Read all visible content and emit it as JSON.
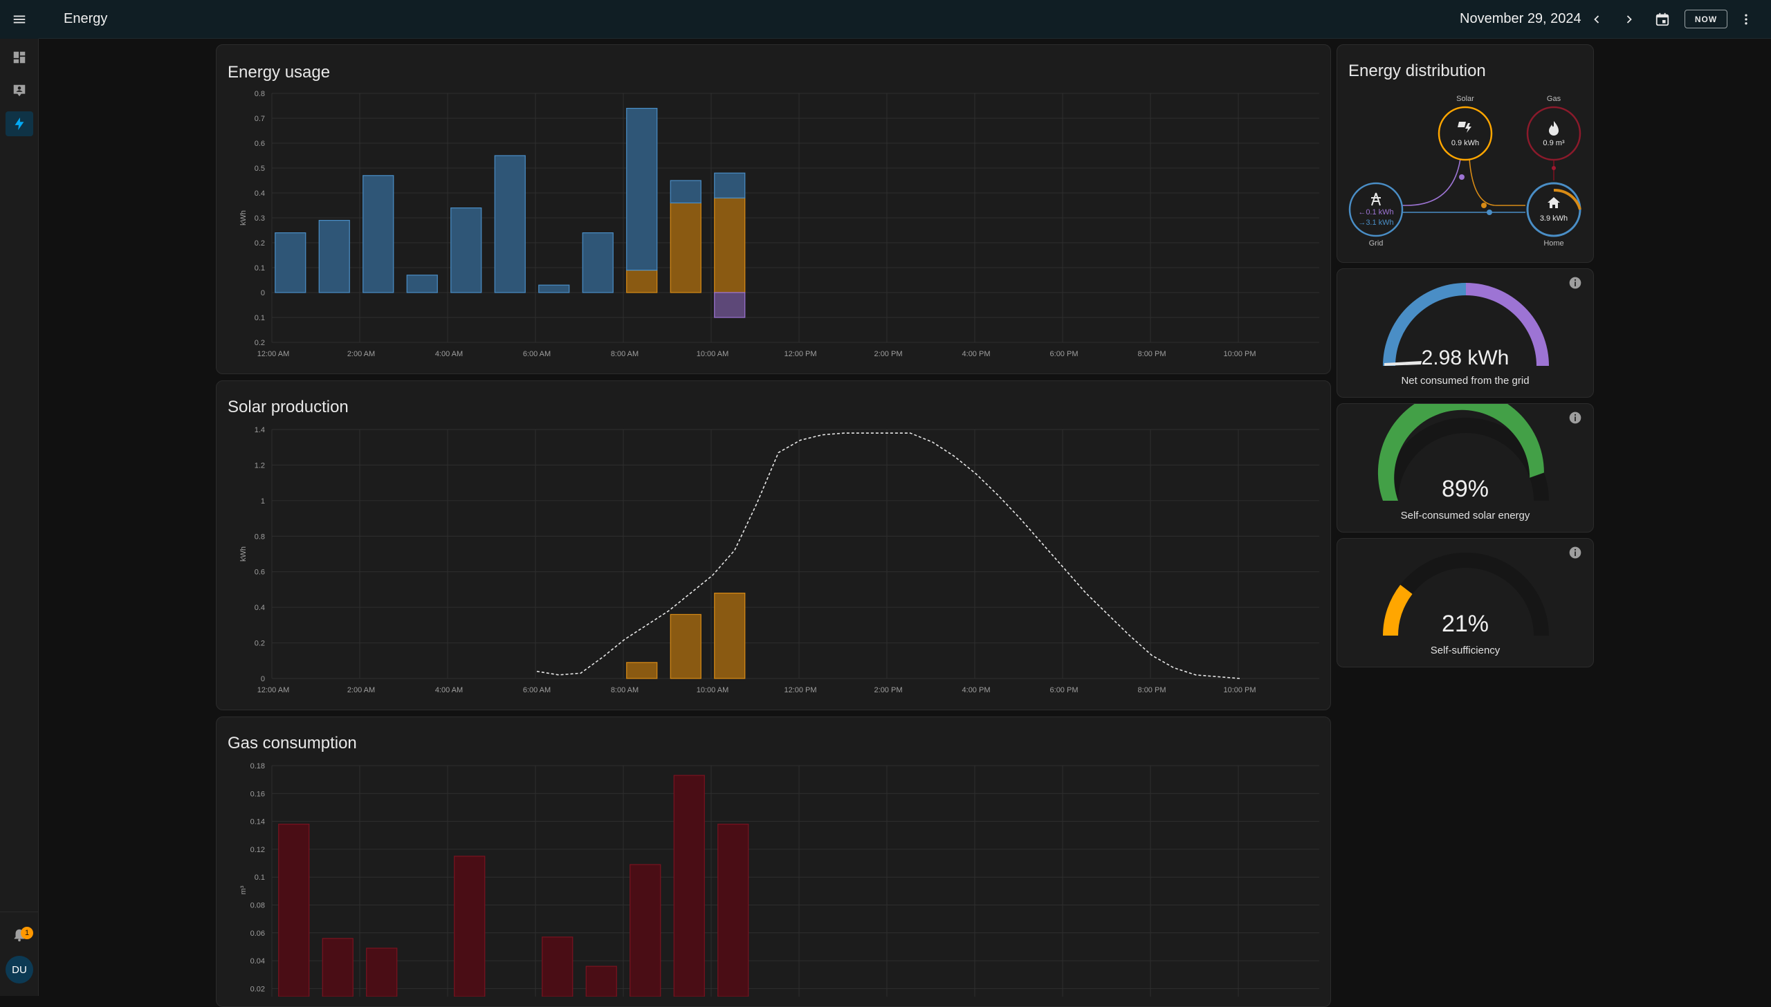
{
  "header": {
    "title": "Energy",
    "date": "November 29, 2024",
    "now_label": "NOW"
  },
  "sidebar": {
    "notification_count": "1",
    "user_initials": "DU"
  },
  "colors": {
    "grid": "#4a8ec6",
    "solar": "#d88b16",
    "return": "#9d74d4",
    "gas": "#7a1320",
    "gauge_green": "#43a047",
    "gauge_orange": "#ffa600"
  },
  "energy_usage": {
    "title": "Energy usage",
    "ylabel": "kWh",
    "chart_data": {
      "type": "bar",
      "ylim": [
        -0.2,
        0.8
      ],
      "yticks": [
        "0.8",
        "0.7",
        "0.6",
        "0.5",
        "0.4",
        "0.3",
        "0.2",
        "0.1",
        "0",
        "0.1",
        "0.2"
      ],
      "xticks": [
        "12:00 AM",
        "2:00 AM",
        "4:00 AM",
        "6:00 AM",
        "8:00 AM",
        "10:00 AM",
        "12:00 PM",
        "2:00 PM",
        "4:00 PM",
        "6:00 PM",
        "8:00 PM",
        "10:00 PM"
      ],
      "hours": [
        0,
        1,
        2,
        3,
        4,
        5,
        6,
        7,
        8,
        9,
        10
      ],
      "series": [
        {
          "name": "grid",
          "values": [
            0.24,
            0.29,
            0.47,
            0.07,
            0.34,
            0.55,
            0.03,
            0.24,
            0.65,
            0.09,
            0.1
          ]
        },
        {
          "name": "solar",
          "values": [
            0,
            0,
            0,
            0,
            0,
            0,
            0,
            0,
            0.09,
            0.36,
            0.38
          ]
        },
        {
          "name": "return",
          "values": [
            0,
            0,
            0,
            0,
            0,
            0,
            0,
            0,
            0,
            0,
            -0.1
          ]
        }
      ]
    }
  },
  "solar_production": {
    "title": "Solar production",
    "ylabel": "kWh",
    "chart_data": {
      "type": "bar",
      "ylim": [
        0,
        1.4
      ],
      "yticks": [
        "1.4",
        "1.2",
        "1",
        "0.8",
        "0.6",
        "0.4",
        "0.2",
        "0"
      ],
      "xticks": [
        "12:00 AM",
        "2:00 AM",
        "4:00 AM",
        "6:00 AM",
        "8:00 AM",
        "10:00 AM",
        "12:00 PM",
        "2:00 PM",
        "4:00 PM",
        "6:00 PM",
        "8:00 PM",
        "10:00 PM"
      ],
      "bars": {
        "hours": [
          8,
          9,
          10
        ],
        "values": [
          0.09,
          0.36,
          0.48
        ]
      },
      "forecast": {
        "x": [
          6,
          6.5,
          7,
          7.5,
          8,
          8.5,
          9,
          9.5,
          10,
          10.5,
          11,
          11.5,
          12,
          12.5,
          13,
          13.5,
          14,
          14.5,
          15,
          15.5,
          16,
          16.5,
          17,
          17.5,
          18,
          18.5,
          19,
          19.5,
          20,
          20.5,
          21,
          21.5,
          22
        ],
        "y": [
          0.04,
          0.02,
          0.03,
          0.12,
          0.22,
          0.3,
          0.38,
          0.48,
          0.58,
          0.72,
          0.98,
          1.27,
          1.34,
          1.37,
          1.38,
          1.38,
          1.38,
          1.38,
          1.33,
          1.25,
          1.15,
          1.03,
          0.9,
          0.76,
          0.62,
          0.48,
          0.36,
          0.24,
          0.13,
          0.06,
          0.02,
          0.01,
          0.0
        ]
      }
    }
  },
  "gas_consumption": {
    "title": "Gas consumption",
    "ylabel": "m³",
    "chart_data": {
      "type": "bar",
      "ylim": [
        0,
        0.18
      ],
      "yticks": [
        "0.18",
        "0.16",
        "0.14",
        "0.12",
        "0.1",
        "0.08",
        "0.06",
        "0.04",
        "0.02"
      ],
      "hours": [
        0,
        1,
        2,
        4,
        6,
        7,
        8,
        9,
        10
      ],
      "values": [
        0.138,
        0.056,
        0.049,
        0.115,
        0.057,
        0.036,
        0.109,
        0.173,
        0.138
      ]
    }
  },
  "distribution": {
    "title": "Energy distribution",
    "solar_label": "Solar",
    "solar_value": "0.9 kWh",
    "gas_label": "Gas",
    "gas_value": "0.9 m³",
    "grid_label": "Grid",
    "grid_out": "0.1 kWh",
    "grid_in": "3.1 kWh",
    "home_label": "Home",
    "home_value": "3.9 kWh"
  },
  "gauges": [
    {
      "value": "2.98 kWh",
      "label": "Net consumed from the grid"
    },
    {
      "value": "89%",
      "label": "Self-consumed solar energy",
      "fraction": 0.89
    },
    {
      "value": "21%",
      "label": "Self-sufficiency",
      "fraction": 0.21
    }
  ]
}
